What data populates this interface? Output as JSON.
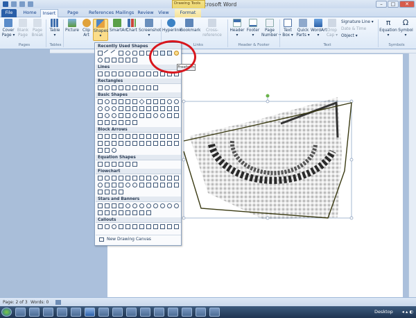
{
  "title_bar": {
    "title": "Doc2 - Microsoft Word",
    "contextual_tab_group": "Drawing Tools",
    "min": "–",
    "max": "□",
    "close": "✕"
  },
  "tabs": [
    "File",
    "Home",
    "Insert",
    "Page Layout",
    "References",
    "Mailings",
    "Review",
    "View",
    "Format"
  ],
  "ribbon": {
    "pages": {
      "cover": "Cover\nPage ▾",
      "blank": "Blank\nPage",
      "break": "Page\nBreak",
      "label": "Pages"
    },
    "tables": {
      "table": "Table\n▾",
      "label": "Tables"
    },
    "illustrations": {
      "picture": "Picture",
      "clip": "Clip\nArt",
      "shapes": "Shapes\n▾",
      "smartart": "SmartArt",
      "chart": "Chart",
      "screenshot": "Screenshot\n▾"
    },
    "links": {
      "hyperlink": "Hyperlink",
      "bookmark": "Bookmark",
      "crossref": "Cross-reference",
      "label": "Links"
    },
    "header_footer": {
      "header": "Header\n▾",
      "footer": "Footer\n▾",
      "page_number": "Page\nNumber ▾",
      "label": "Header & Footer"
    },
    "text": {
      "textbox": "Text\nBox ▾",
      "quickparts": "Quick\nParts ▾",
      "wordart": "WordArt\n▾",
      "dropcap": "Drop\nCap ▾",
      "signature": "Signature Line ▾",
      "datetime": "Date & Time",
      "object": "Object ▾",
      "label": "Text"
    },
    "symbols": {
      "equation": "Equation\n▾",
      "symbol": "Symbol\n▾",
      "label": "Symbols"
    }
  },
  "shapes_menu": {
    "sections": [
      "Recently Used Shapes",
      "Lines",
      "Rectangles",
      "Basic Shapes",
      "Block Arrows",
      "Equation Shapes",
      "Flowchart",
      "Stars and Banners",
      "Callouts"
    ],
    "new_canvas": "New Drawing Canvas"
  },
  "tooltip": "Freeform",
  "status_bar": {
    "page": "Page: 2 of 3",
    "words": "Words: 0"
  },
  "taskbar": {
    "desktop": "Desktop",
    "tray": "◂ ▴ ◐"
  },
  "colors": {
    "annotation_red": "#d8161d",
    "freeform_stroke": "#3a3a12",
    "selected_shape": "#fbdd8a"
  }
}
